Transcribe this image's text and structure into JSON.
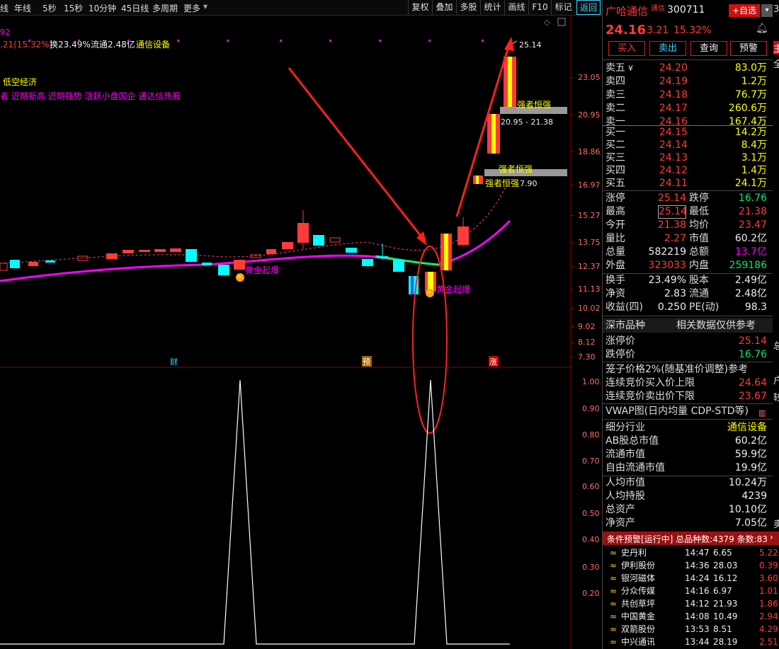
{
  "toolbar": {
    "left_items": [
      "线",
      "年线",
      "5秒",
      "15秒",
      "10分钟",
      "45日线",
      "多周期",
      "更多"
    ],
    "right_buttons": [
      "复权",
      "叠加",
      "多股",
      "统计",
      "画线",
      "F10",
      "标记",
      "返回"
    ]
  },
  "chart": {
    "info_prefix": ".21(15.32%)",
    "turnover": "换23.49%",
    "float_cap": "流通2.48亿",
    "sector": "通信设备",
    "tag_line1": "低空经济",
    "tag_line2": "者 近期新高 近期强势 活跃小盘国企 通达信热股",
    "topleft_num": "92",
    "price_axis": [
      "23.05",
      "20.95",
      "18.86",
      "16.97",
      "15.27",
      "13.75",
      "12.37",
      "11.13",
      "10.02",
      "9.02",
      "8.12",
      "7.30"
    ],
    "lower_axis": [
      "1.00",
      "0.90",
      "0.80",
      "0.70",
      "0.60",
      "0.50",
      "0.40",
      "0.30",
      "0.20"
    ],
    "peak_label": "25.14",
    "strong_label_1": "强者恒强",
    "strong_range": "20.95 - 21.38",
    "strong_label_2": "强者恒强",
    "strong_label_3": "强者恒强",
    "strong_label_3_tail": "7.90",
    "signal_label": "黄金起爆",
    "bottom_markers": [
      "财",
      "预",
      "涨"
    ],
    "colors": {
      "up": "#ff3333",
      "down": "#00ffff",
      "ma_main": "#ff00ff",
      "ma_green": "#00ff66",
      "annotation": "#ff2020"
    }
  },
  "stock": {
    "name": "广哈通信",
    "tag": "通信",
    "code": "300711",
    "add_button": "+自选",
    "price": "24.16",
    "change": "3.21",
    "pct": "15.32%",
    "buttons": [
      "买入",
      "卖出",
      "查询",
      "预警"
    ]
  },
  "order_book": {
    "asks": [
      {
        "label": "卖五",
        "price": "24.20",
        "vol": "83.0万",
        "yen": "¥"
      },
      {
        "label": "卖四",
        "price": "24.19",
        "vol": "1.2万"
      },
      {
        "label": "卖三",
        "price": "24.18",
        "vol": "76.7万"
      },
      {
        "label": "卖二",
        "price": "24.17",
        "vol": "260.6万"
      },
      {
        "label": "卖一",
        "price": "24.16",
        "vol": "167.4万"
      }
    ],
    "bids": [
      {
        "label": "买一",
        "price": "24.15",
        "vol": "14.2万"
      },
      {
        "label": "买二",
        "price": "24.14",
        "vol": "8.4万"
      },
      {
        "label": "买三",
        "price": "24.13",
        "vol": "3.1万"
      },
      {
        "label": "买四",
        "price": "24.12",
        "vol": "1.4万"
      },
      {
        "label": "买五",
        "price": "24.11",
        "vol": "24.1万"
      }
    ]
  },
  "stats": [
    {
      "l1": "涨停",
      "v1": "25.14",
      "c1": "red",
      "l2": "跌停",
      "v2": "16.76",
      "c2": "grn"
    },
    {
      "l1": "最高",
      "v1": "25.14",
      "c1": "red",
      "l2": "最低",
      "v2": "21.38",
      "c2": "red"
    },
    {
      "l1": "今开",
      "v1": "21.38",
      "c1": "red",
      "l2": "均价",
      "v2": "23.47",
      "c2": "red"
    },
    {
      "l1": "量比",
      "v1": "2.27",
      "c1": "red",
      "l2": "市值",
      "v2": "60.2亿",
      "c2": "wht"
    },
    {
      "l1": "总量",
      "v1": "582219",
      "c1": "wht",
      "l2": "总额",
      "v2": "13.7亿",
      "c2": "mag"
    },
    {
      "l1": "外盘",
      "v1": "323033",
      "c1": "red",
      "l2": "内盘",
      "v2": "259186",
      "c2": "grn"
    },
    {
      "l1": "换手",
      "v1": "23.49%",
      "c1": "wht",
      "l2": "股本",
      "v2": "2.49亿",
      "c2": "wht"
    },
    {
      "l1": "净资",
      "v1": "2.83",
      "c1": "wht",
      "l2": "流通",
      "v2": "2.48亿",
      "c2": "wht"
    },
    {
      "l1": "收益(四)",
      "v1": "0.250",
      "c1": "wht",
      "l2": "PE(动)",
      "v2": "98.3",
      "c2": "wht"
    }
  ],
  "market": {
    "label": "深市品种",
    "note": "相关数据仅供参考"
  },
  "limits": [
    {
      "label": "涨停价",
      "value": "25.14",
      "color": "red"
    },
    {
      "label": "跌停价",
      "value": "16.76",
      "color": "grn"
    }
  ],
  "cage": {
    "title": "笼子价格2%(随基准价调整)参考",
    "rows": [
      {
        "label": "连续竞价买入价上限",
        "value": "24.64"
      },
      {
        "label": "连续竞价卖出价下限",
        "value": "23.67"
      }
    ]
  },
  "vwap": "VWAP图(日内均量 CDP-STD等)",
  "industry": {
    "label": "细分行业",
    "value": "通信设备"
  },
  "caps": [
    {
      "label": "AB股总市值",
      "value": "60.2亿"
    },
    {
      "label": "流通市值",
      "value": "59.9亿"
    },
    {
      "label": "自由流通市值",
      "value": "19.9亿"
    }
  ],
  "per_capita": [
    {
      "label": "人均市值",
      "value": "10.24万"
    },
    {
      "label": "人均持股",
      "value": "4239"
    },
    {
      "label": "总资产",
      "value": "10.10亿"
    },
    {
      "label": "净资产",
      "value": "7.05亿"
    }
  ],
  "alerts": {
    "header": "条件预警[运行中] 总品种数:4379 条数:83",
    "rows": [
      {
        "name": "史丹利",
        "time": "14:47",
        "price": "6.65",
        "pct": "5.22"
      },
      {
        "name": "伊利股份",
        "time": "14:36",
        "price": "28.03",
        "pct": "0.39"
      },
      {
        "name": "银河磁体",
        "time": "14:24",
        "price": "16.12",
        "pct": "3.60"
      },
      {
        "name": "分众传媒",
        "time": "14:16",
        "price": "6.97",
        "pct": "1.01"
      },
      {
        "name": "共创草坪",
        "time": "14:12",
        "price": "21.93",
        "pct": "1.86"
      },
      {
        "name": "中国黄金",
        "time": "14:08",
        "price": "10.49",
        "pct": "2.94"
      },
      {
        "name": "双箭股份",
        "time": "13:53",
        "price": "8.51",
        "pct": "4.29"
      },
      {
        "name": "中兴通讯",
        "time": "13:44",
        "price": "28.19",
        "pct": "2.51"
      }
    ]
  },
  "edge_glyphs": [
    "3",
    "主",
    "全",
    "总",
    "户",
    "较",
    "卖"
  ]
}
